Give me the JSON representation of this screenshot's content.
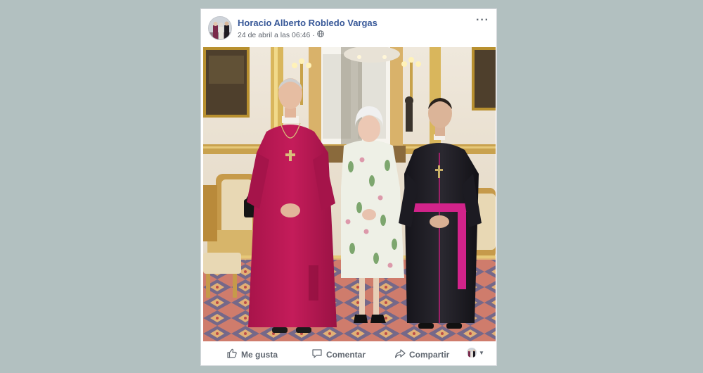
{
  "post": {
    "author": "Horacio Alberto Robledo Vargas",
    "timestamp": "24 de abril a las 06:46 ·",
    "privacy_icon": "globe-icon",
    "menu_icon": "more-options-icon"
  },
  "actions": {
    "like_label": "Me gusta",
    "comment_label": "Comentar",
    "share_label": "Compartir"
  },
  "colors": {
    "link_blue": "#385898",
    "page_bg": "#b2c0c0"
  }
}
